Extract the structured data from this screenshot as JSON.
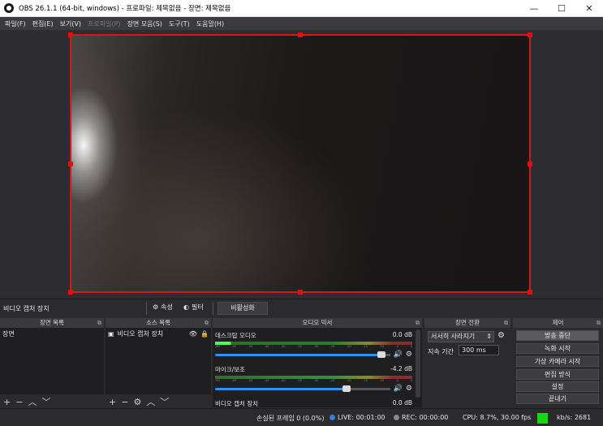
{
  "window": {
    "title": "OBS 26.1.1 (64-bit, windows) - 프로파일: 제목없음 - 장면: 제목없음",
    "controls": [
      "—",
      "☐",
      "✕"
    ]
  },
  "menu": [
    {
      "label": "파일(F)",
      "enabled": true
    },
    {
      "label": "편집(E)",
      "enabled": true
    },
    {
      "label": "보기(V)",
      "enabled": true
    },
    {
      "label": "프로파일(P)",
      "enabled": false
    },
    {
      "label": "장면 모음(S)",
      "enabled": true
    },
    {
      "label": "도구(T)",
      "enabled": true
    },
    {
      "label": "도움말(H)",
      "enabled": true
    }
  ],
  "source_toolbar": {
    "source_name": "비디오 캡처 장치",
    "properties_label": "속성",
    "filters_label": "필터",
    "deactivate_label": "비활성화"
  },
  "docks": {
    "scenes": {
      "title": "장면 목록",
      "items": [
        "장면"
      ]
    },
    "sources": {
      "title": "소스 목록",
      "items": [
        {
          "name": "비디오 캡처 장치",
          "visible": true,
          "locked": false
        }
      ]
    },
    "mixer": {
      "title": "오디오 믹서",
      "tracks": [
        {
          "name": "데스크탑 오디오",
          "db": "0.0 dB",
          "volume": 0.95
        },
        {
          "name": "마이크/보조",
          "db": "-4.2 dB",
          "volume": 0.75
        },
        {
          "name": "비디오 캡처 장치",
          "db": "0.0 dB"
        }
      ],
      "tick_labels": [
        "-60",
        "-55",
        "-50",
        "-45",
        "-40",
        "-35",
        "-30",
        "-25",
        "-20",
        "-15",
        "-10",
        "-5",
        "0"
      ]
    },
    "transitions": {
      "title": "장면 전환",
      "selected": "서서히 사라지기",
      "duration_label": "지속 기간",
      "duration_value": "300 ms"
    },
    "controls": {
      "title": "제어",
      "buttons": [
        "방송 중단",
        "녹화 시작",
        "가상 카메라 시작",
        "편집 방식",
        "설정",
        "끝내기"
      ]
    }
  },
  "status": {
    "dropped_frames": "손실된 프레임 0 (0.0%)",
    "live": "LIVE: 00:01:00",
    "rec": "REC: 00:00:00",
    "cpu": "CPU: 8.7%, 30.00 fps",
    "kbps": "kb/s: 2681",
    "colors": {
      "live": "#3a7bd5",
      "rec": "#8a8a8a",
      "bitrate": "#16d616"
    }
  }
}
